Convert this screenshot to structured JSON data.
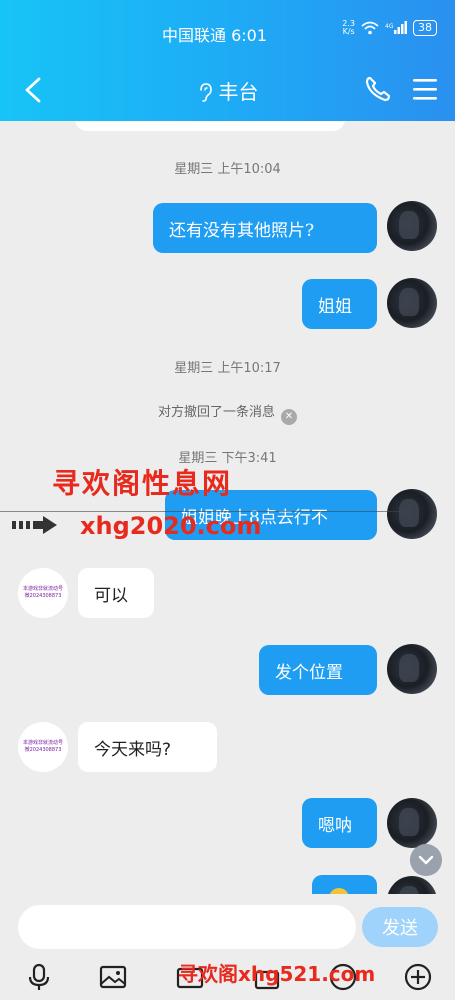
{
  "status": {
    "carrier_time": "中国联通 6:01",
    "speed": "2.3",
    "speed_unit": "K/s",
    "battery": "38"
  },
  "header": {
    "title": "丰台",
    "ear_icon": "ear-icon"
  },
  "messages": {
    "time1": "星期三 上午10:04",
    "m1": "还有没有其他照片?",
    "m2": "姐姐",
    "time2": "星期三 上午10:17",
    "recall": "对方撤回了一条消息",
    "time3": "星期三 下午3:41",
    "m3": "姐姐晚上8点去行不",
    "m4": "可以",
    "m5": "发个位置",
    "m6": "今天来吗?",
    "m7": "嗯呐"
  },
  "other_avatar_text": {
    "line1": "本游戏非就流动号",
    "line2": "微2024308873"
  },
  "watermarks": {
    "w1": "寻欢阁性息网",
    "w2": "xhg2020.com",
    "w3": "寻欢阁xhg521.com"
  },
  "input": {
    "placeholder": "",
    "send_label": "发送"
  },
  "colors": {
    "accent": "#1e9df3",
    "header_start": "#17c4f7",
    "header_end": "#2a90f0",
    "send_disabled": "#9fd3fb",
    "watermark": "#e8291d"
  }
}
